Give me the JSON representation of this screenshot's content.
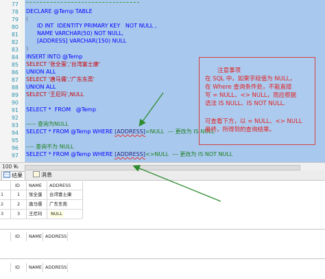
{
  "editor": {
    "line_numbers": [
      "77",
      "78",
      "79",
      "80",
      "81",
      "82",
      "83",
      "84",
      "85",
      "86",
      "87",
      "88",
      "89",
      "90",
      "91",
      "92",
      "93",
      "94",
      "95",
      "96",
      "97"
    ],
    "lines": {
      "declare": "DECLARE @Temp TABLE",
      "open_paren": "(",
      "col_id": "ID INT  IDENTITY PRIMARY KEY   NOT NULL ,",
      "col_name": "NAME VARCHAR(50) NOT NULL,",
      "col_address": "[ADDRESS] VARCHAR(150) NULL",
      "close_paren": ")",
      "insert": "INSERT INTO @Temp",
      "sel1": "SELECT '张全蛋','台湾富士康'",
      "union1": "UNION ALL",
      "sel2": "SELECT '唐马儒','广东东莞'",
      "union2": "UNION ALL",
      "sel3": "SELECT '王尼玛',NULL",
      "select_all": "SELECT *  FROM   @Temp",
      "comment_query_null": "----- 查询为NULL",
      "query1_pre": "SELECT * FROM @Temp WHERE ",
      "query1_col": "[ADDRESS]",
      "query1_post": "=NULL  --- 更改为 IS NULL",
      "comment_query_notnull": "---- 查询不为 NULL",
      "query2_pre": "SELECT * FROM @Temp WHERE ",
      "query2_col": "[ADDRESS]",
      "query2_post": "<>NULL  --- 更改为 IS NOT NULL"
    }
  },
  "note": {
    "title": "注意事项",
    "lines": [
      "在 SQL 中，如果字段值为 NULL，",
      "在 Where 查询条件处，不能直接",
      "写 = NULL、<> NULL，而应根据",
      "语法 IS NULL、IS NOT NULL.",
      "",
      "可查看下方，以 = NULL、<> NULL",
      "最终，所得到的查询结果。"
    ]
  },
  "status": {
    "zoom": "100 %"
  },
  "tabs": {
    "results": "结果",
    "messages": "消息"
  },
  "results": {
    "grid1": {
      "headers": [
        "ID",
        "NAME",
        "ADDRESS"
      ],
      "rows": [
        {
          "row": "1",
          "id": "1",
          "name": "张全蛋",
          "address": "台湾富士康"
        },
        {
          "row": "2",
          "id": "2",
          "name": "唐马儒",
          "address": "广东东莞"
        },
        {
          "row": "3",
          "id": "3",
          "name": "王尼玛",
          "address": "NULL"
        }
      ]
    },
    "grid2": {
      "headers": [
        "ID",
        "NAME",
        "ADDRESS"
      ]
    },
    "grid3": {
      "headers": [
        "ID",
        "NAME",
        "ADDRESS"
      ]
    }
  },
  "colors": {
    "selection": "#a8c8ee",
    "annotation": "#e02020",
    "arrow": "#2e8b2e"
  }
}
